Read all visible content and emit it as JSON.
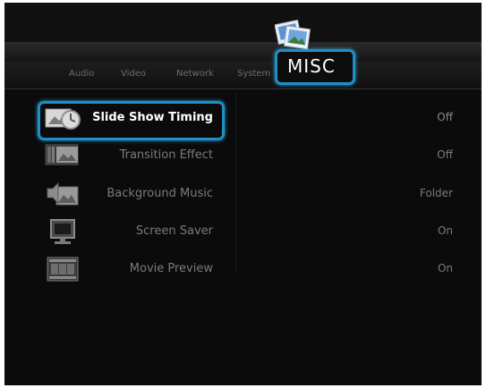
{
  "tabs": [
    {
      "label": "Audio"
    },
    {
      "label": "Video"
    },
    {
      "label": "Network"
    },
    {
      "label": "System"
    }
  ],
  "active_tab": {
    "label": "MISC",
    "icon": "photo-icon"
  },
  "menu": [
    {
      "label": "Slide Show Timing",
      "value": "Off",
      "icon": "slideshow-timer-icon",
      "selected": true
    },
    {
      "label": "Transition Effect",
      "value": "Off",
      "icon": "transition-effect-icon",
      "selected": false
    },
    {
      "label": "Background Music",
      "value": "Folder",
      "icon": "background-music-icon",
      "selected": false
    },
    {
      "label": "Screen Saver",
      "value": "On",
      "icon": "monitor-icon",
      "selected": false
    },
    {
      "label": "Movie Preview",
      "value": "On",
      "icon": "film-strip-icon",
      "selected": false
    }
  ],
  "colors": {
    "accent": "#1f8fc5",
    "background": "#0b0b0c",
    "text_dim": "#7b7b7b",
    "text_active": "#ffffff"
  }
}
